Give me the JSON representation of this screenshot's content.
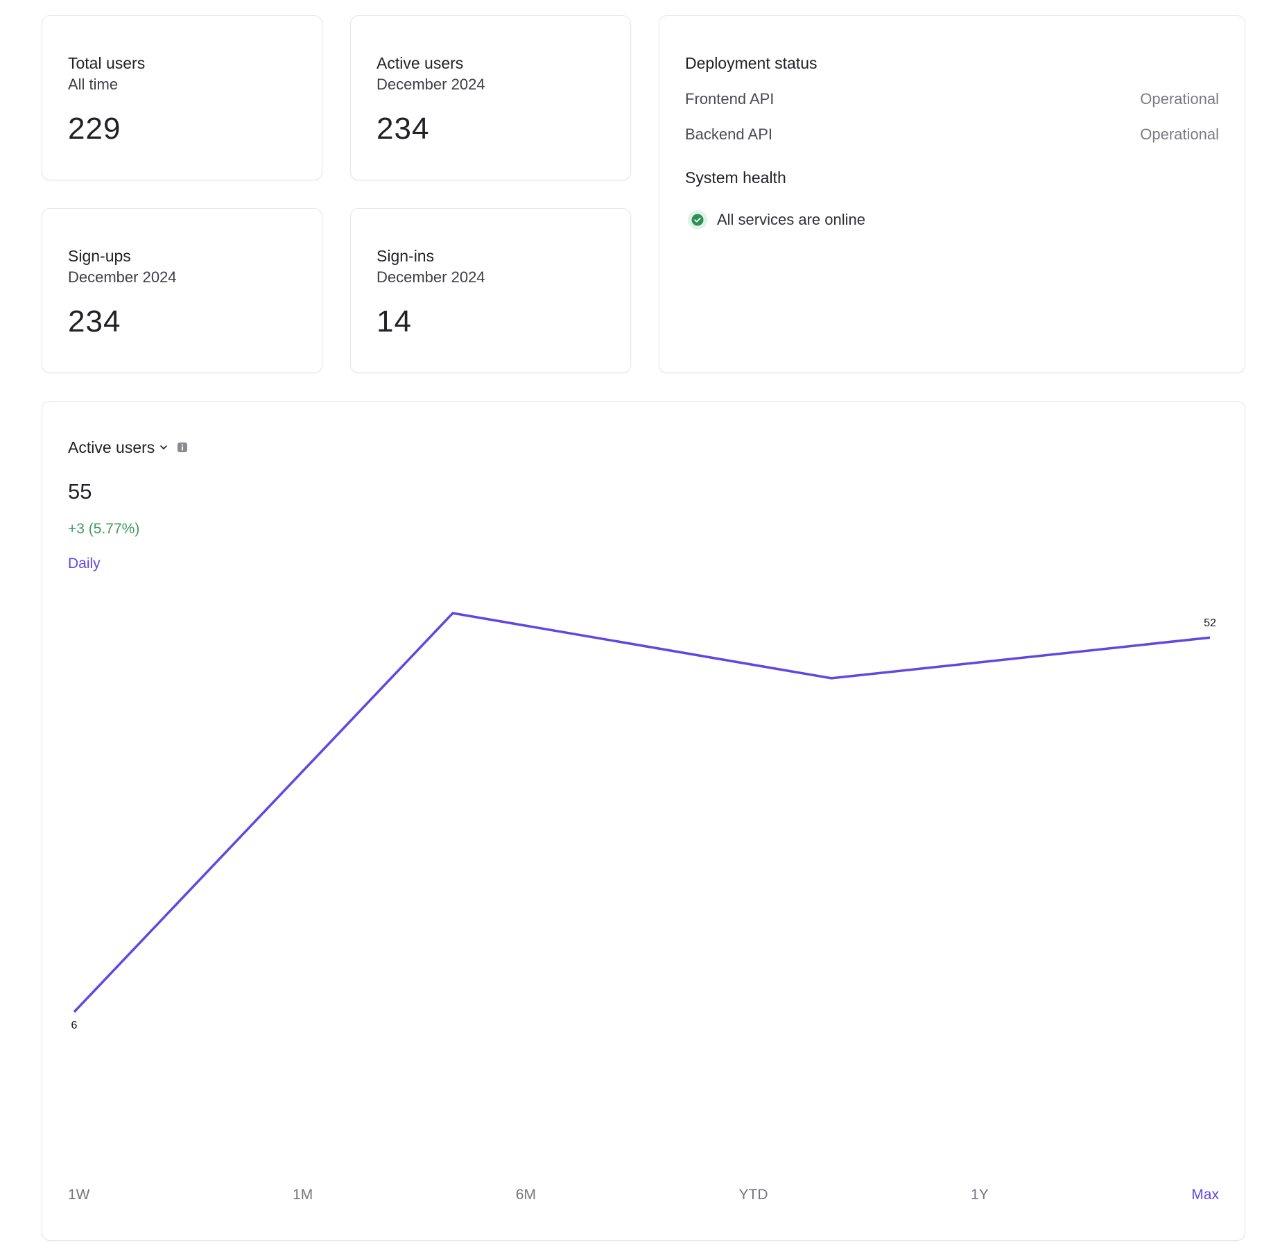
{
  "stats": {
    "total_users": {
      "title": "Total users",
      "subtitle": "All time",
      "value": "229"
    },
    "active_users": {
      "title": "Active users",
      "subtitle": "December 2024",
      "value": "234"
    },
    "sign_ups": {
      "title": "Sign-ups",
      "subtitle": "December 2024",
      "value": "234"
    },
    "sign_ins": {
      "title": "Sign-ins",
      "subtitle": "December 2024",
      "value": "14"
    }
  },
  "deployment": {
    "heading": "Deployment status",
    "services": [
      {
        "name": "Frontend API",
        "status": "Operational"
      },
      {
        "name": "Backend API",
        "status": "Operational"
      }
    ],
    "health_heading": "System health",
    "health_text": "All services are online"
  },
  "chart_panel": {
    "metric_label": "Active users",
    "metric_value": "55",
    "change": "+3 (5.77%)",
    "interval": "Daily",
    "ranges": [
      "1W",
      "1M",
      "6M",
      "YTD",
      "1Y",
      "Max"
    ],
    "active_range": "Max"
  },
  "colors": {
    "accent": "#6346e0",
    "positive": "#3e9a5c",
    "health_check": "#2f8f55"
  },
  "chart_data": {
    "type": "line",
    "x": [
      0,
      1,
      2,
      3
    ],
    "values": [
      6,
      55,
      47,
      52
    ],
    "point_labels": [
      "6",
      "",
      "",
      "52"
    ],
    "title": "",
    "xlabel": "",
    "ylabel": "",
    "grid": false,
    "axes_visible": false,
    "color": "#6346e0"
  }
}
